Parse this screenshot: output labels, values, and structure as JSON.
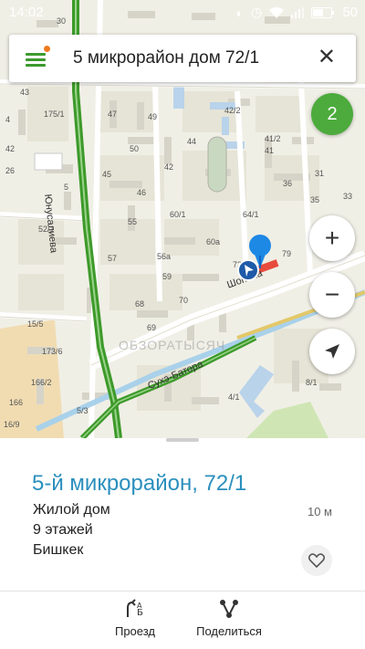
{
  "status_bar": {
    "time": "14:02",
    "battery": "50"
  },
  "search": {
    "query": "5 микрорайон дом 72/1"
  },
  "map": {
    "cluster_count": "2",
    "streets": [
      "Юнусалиева",
      "Шопена",
      "Сухэ-Батора"
    ],
    "watermark": "ОБЗОРАТЫСЯЧ",
    "buildings": [
      "47",
      "49",
      "50",
      "42/2",
      "41/2",
      "41",
      "42",
      "45",
      "46",
      "44",
      "36",
      "31",
      "35",
      "33",
      "60/1",
      "64/1",
      "55",
      "52/1",
      "56а",
      "60а",
      "57",
      "59",
      "79",
      "68",
      "70",
      "69",
      "73",
      "15/5",
      "173/6",
      "166/2",
      "166",
      "5/3",
      "4/1",
      "8/1",
      "16/9",
      "175/1",
      "43",
      "42",
      "26",
      "30",
      "5",
      "4"
    ]
  },
  "place": {
    "title": "5-й микрорайон, 72/1",
    "type": "Жилой дом",
    "floors": "9 этажей",
    "city": "Бишкек",
    "distance": "10 м"
  },
  "actions": {
    "route_label": "Проезд",
    "share_label": "Поделиться"
  },
  "colors": {
    "accent": "#4cab3c",
    "title": "#2b8fbd",
    "road_green": "#3d9a2a"
  }
}
